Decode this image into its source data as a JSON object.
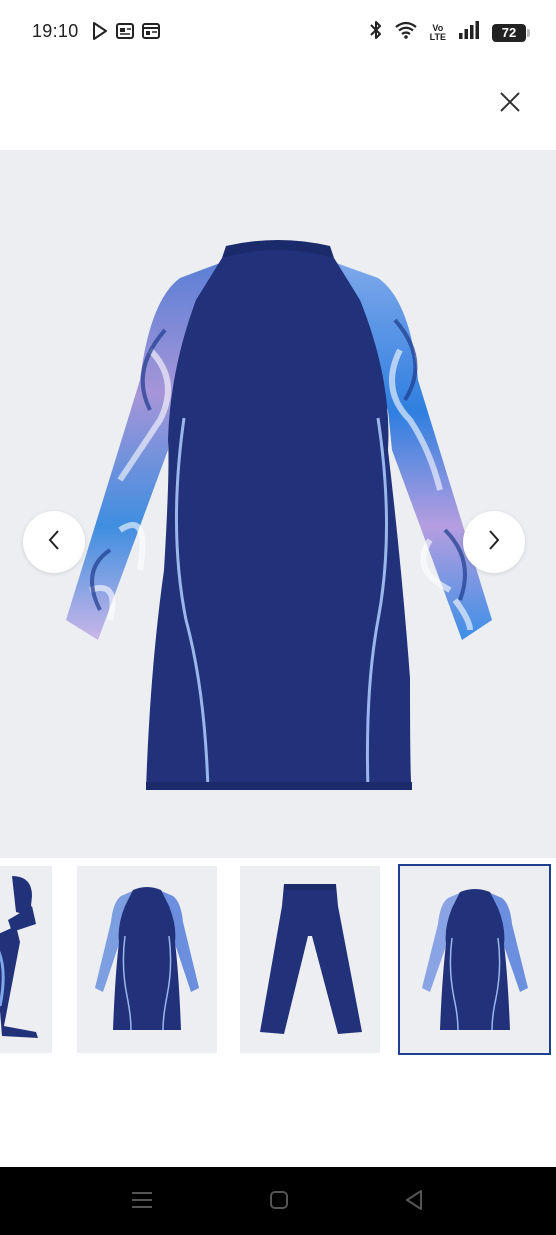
{
  "status_bar": {
    "time": "19:10",
    "battery": "72",
    "left_icons": [
      "play-store-icon",
      "news-icon",
      "news-icon"
    ],
    "right_icons": [
      "bluetooth-icon",
      "wifi-icon",
      "volte-icon",
      "signal-icon",
      "battery-icon"
    ],
    "volte_top": "Vo",
    "volte_bottom": "LTE"
  },
  "gallery": {
    "current_index": 4,
    "thumbnails": [
      {
        "name": "thumbnail-hood-and-tunic"
      },
      {
        "name": "thumbnail-tunic-front"
      },
      {
        "name": "thumbnail-pants"
      },
      {
        "name": "thumbnail-tunic-back"
      }
    ]
  },
  "colors": {
    "navy": "#22327a",
    "background": "#eceef1",
    "selected_border": "#1d3f8f"
  }
}
